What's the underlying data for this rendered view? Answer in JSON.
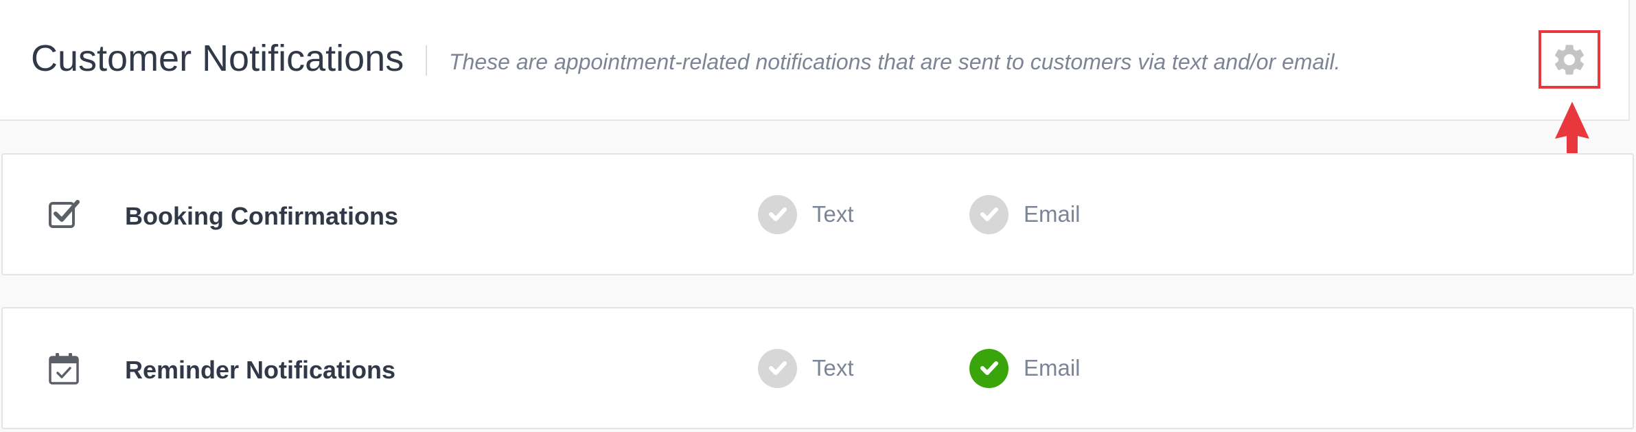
{
  "header": {
    "title": "Customer Notifications",
    "subtitle": "These are appointment-related notifications that are sent to customers via text and/or email.",
    "settings_icon": "gear-icon"
  },
  "notifications": [
    {
      "label": "Booking Confirmations",
      "icon": "checkbox-icon",
      "text": {
        "label": "Text",
        "enabled": false
      },
      "email": {
        "label": "Email",
        "enabled": false
      }
    },
    {
      "label": "Reminder Notifications",
      "icon": "calendar-check-icon",
      "text": {
        "label": "Text",
        "enabled": false
      },
      "email": {
        "label": "Email",
        "enabled": true
      }
    }
  ],
  "colors": {
    "accent_enabled": "#3aa50b",
    "disabled": "#d7d7d7",
    "annotation": "#e8383d"
  }
}
